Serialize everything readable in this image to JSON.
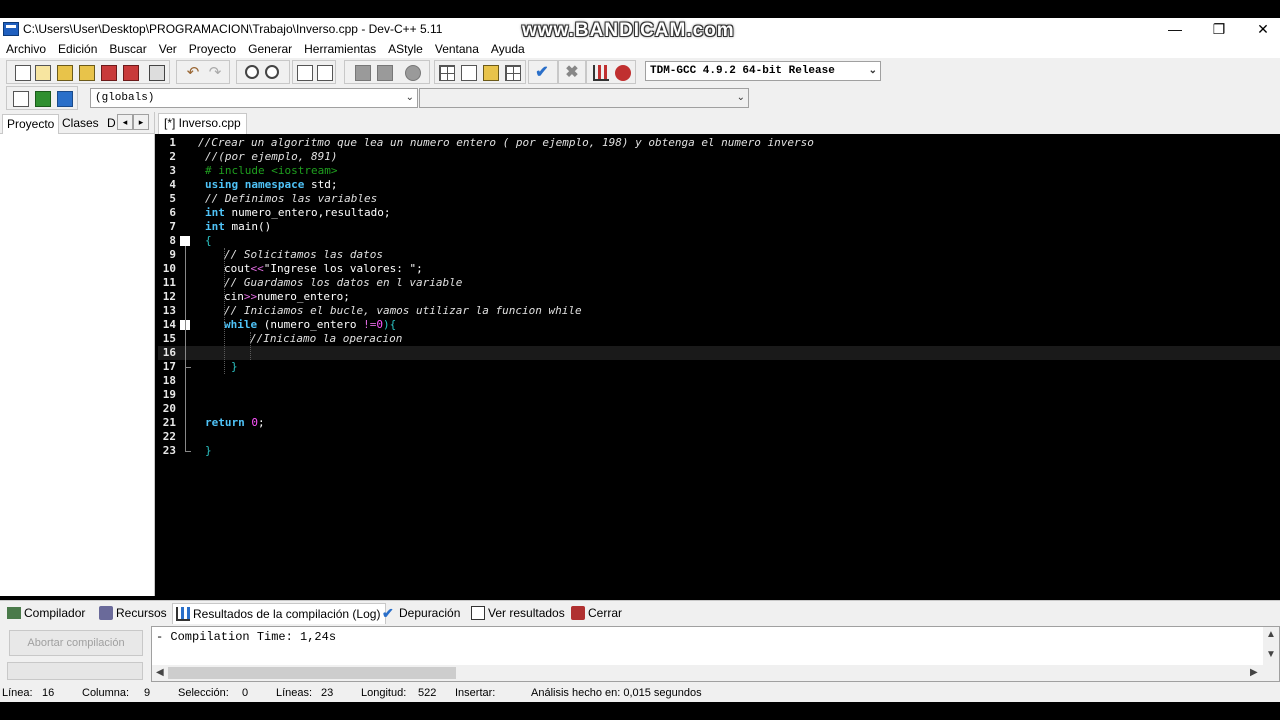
{
  "window": {
    "title": "C:\\Users\\User\\Desktop\\PROGRAMACION\\Trabajo\\Inverso.cpp - Dev-C++ 5.11",
    "watermark": "www.BANDICAM.com",
    "minimize": "—",
    "maximize": "❐",
    "close": "✕"
  },
  "menu": [
    "Archivo",
    "Edición",
    "Buscar",
    "Ver",
    "Proyecto",
    "Generar",
    "Herramientas",
    "AStyle",
    "Ventana",
    "Ayuda"
  ],
  "toolbar": {
    "compiler_select": "TDM-GCC 4.9.2 64-bit Release",
    "scope_select": "(globals)",
    "member_select": ""
  },
  "left_panel": {
    "tabs": [
      "Proyecto",
      "Clases",
      "D"
    ],
    "scroll_left": "◂",
    "scroll_right": "▸"
  },
  "editor": {
    "tab_label": "[*] Inverso.cpp",
    "current_line": 16,
    "line_numbers": [
      "1",
      "2",
      "3",
      "4",
      "5",
      "6",
      "7",
      "8",
      "9",
      "10",
      "11",
      "12",
      "13",
      "14",
      "15",
      "16",
      "17",
      "18",
      "19",
      "20",
      "21",
      "22",
      "23"
    ]
  },
  "code": {
    "l1": "//Crear un algoritmo que lea un numero entero ( por ejemplo, 198) y obtenga el numero inverso",
    "l2": "//(por ejemplo, 891)",
    "l3": "# include <iostream>",
    "l4_kw": "using namespace",
    "l4_rest": " std;",
    "l5": "// Definimos las variables",
    "l6_kw": "int",
    "l6_rest": " numero_entero,resultado;",
    "l7_kw": "int",
    "l7_rest": " main()",
    "l8": "{",
    "l9": "// Solicitamos las datos",
    "l10_a": "cout",
    "l10_op": "<<",
    "l10_str": "\"Ingrese los valores: \";",
    "l11": "// Guardamos los datos en l variable",
    "l12_a": "cin",
    "l12_op": ">>",
    "l12_rest": "numero_entero;",
    "l13": "// Iniciamos el bucle, vamos utilizar la funcion while",
    "l14_kw": "while",
    "l14_a": " (numero_entero ",
    "l14_op": "!=",
    "l14_num": "0",
    "l14_b": "){",
    "l15": "//Iniciamo la operacion",
    "l17": "}",
    "l21_kw": "return",
    "l21_num": "0",
    "l21_semi": ";",
    "l23": "}"
  },
  "bottom_tabs": [
    "Compilador",
    "Recursos",
    "Resultados de la compilación (Log)",
    "Depuración",
    "Ver resultados",
    "Cerrar"
  ],
  "bottom_panel": {
    "abort_button": "Abortar compilación",
    "log_text": "- Compilation Time: 1,24s"
  },
  "status": {
    "linea_label": "Línea:",
    "linea_value": "16",
    "columna_label": "Columna:",
    "columna_value": "9",
    "seleccion_label": "Selección:",
    "seleccion_value": "0",
    "lineas_label": "Líneas:",
    "lineas_value": "23",
    "longitud_label": "Longitud:",
    "longitud_value": "522",
    "insertar": "Insertar:",
    "analisis": "Análisis hecho en: 0,015 segundos"
  }
}
